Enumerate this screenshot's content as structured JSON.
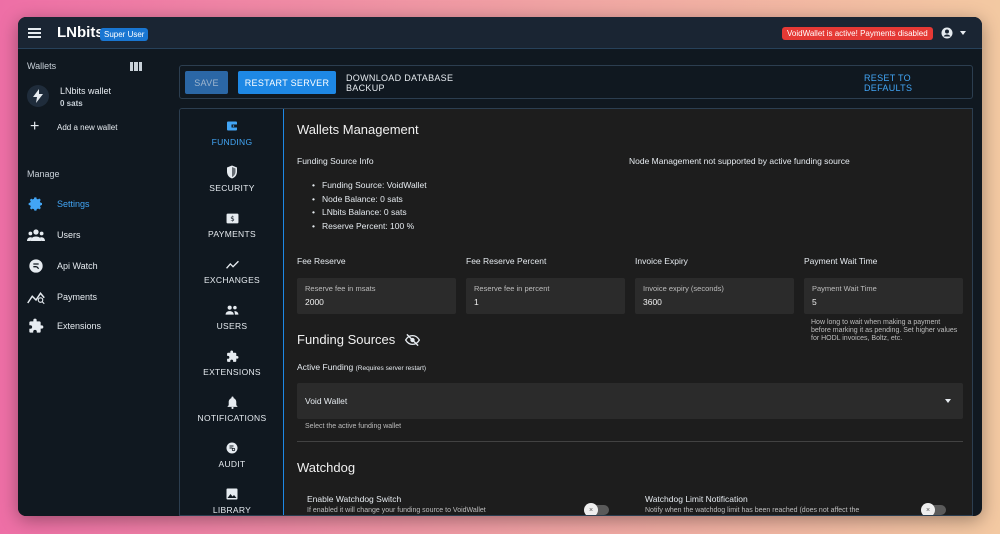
{
  "header": {
    "app_name": "LNbits",
    "role_badge": "Super User",
    "status_badge": "VoidWallet is active! Payments disabled"
  },
  "sidebar": {
    "wallets_title": "Wallets",
    "wallet": {
      "name": "LNbits wallet",
      "balance": "0 sats"
    },
    "add_wallet_label": "Add a new wallet",
    "manage_title": "Manage",
    "items": [
      {
        "label": "Settings",
        "icon": "gear-icon",
        "active": true
      },
      {
        "label": "Users",
        "icon": "users-icon"
      },
      {
        "label": "Api Watch",
        "icon": "api-watch-icon"
      },
      {
        "label": "Payments",
        "icon": "payments-chart-icon"
      },
      {
        "label": "Extensions",
        "icon": "puzzle-icon"
      }
    ]
  },
  "toolbar": {
    "save_label": "SAVE",
    "restart_label": "RESTART SERVER",
    "download_label": "DOWNLOAD DATABASE BACKUP",
    "reset_label": "RESET TO DEFAULTS"
  },
  "tabs": [
    {
      "label": "FUNDING",
      "icon": "wallet-icon",
      "active": true
    },
    {
      "label": "SECURITY",
      "icon": "shield-icon"
    },
    {
      "label": "PAYMENTS",
      "icon": "payments-icon"
    },
    {
      "label": "EXCHANGES",
      "icon": "trend-icon"
    },
    {
      "label": "USERS",
      "icon": "users-icon"
    },
    {
      "label": "EXTENSIONS",
      "icon": "puzzle-icon"
    },
    {
      "label": "NOTIFICATIONS",
      "icon": "bell-icon"
    },
    {
      "label": "AUDIT",
      "icon": "audit-icon"
    },
    {
      "label": "LIBRARY",
      "icon": "image-icon"
    }
  ],
  "main": {
    "title": "Wallets Management",
    "funding_source_info_label": "Funding Source Info",
    "node_management_msg": "Node Management not supported by active funding source",
    "info_items": [
      "Funding Source: VoidWallet",
      "Node Balance: 0 sats",
      "LNbits Balance: 0 sats",
      "Reserve Percent: 100 %"
    ],
    "fields": [
      {
        "title": "Fee Reserve",
        "label": "Reserve fee in msats",
        "value": "2000"
      },
      {
        "title": "Fee Reserve Percent",
        "label": "Reserve fee in percent",
        "value": "1"
      },
      {
        "title": "Invoice Expiry",
        "label": "Invoice expiry (seconds)",
        "value": "3600"
      },
      {
        "title": "Payment Wait Time",
        "label": "Payment Wait Time",
        "value": "5"
      }
    ],
    "payment_wait_hint": "How long to wait when making a payment before marking it as pending. Set higher values for HODL invoices, Boltz, etc.",
    "funding_sources_title": "Funding Sources",
    "active_funding_label": "Active Funding",
    "active_funding_note": "(Requires server restart)",
    "active_funding_value": "Void Wallet",
    "active_funding_hint": "Select the active funding wallet",
    "watchdog_title": "Watchdog",
    "watchdog_switch_title": "Enable Watchdog Switch",
    "watchdog_switch_desc": "If enabled it will change your funding source to VoidWallet",
    "watchdog_limit_title": "Watchdog Limit Notification",
    "watchdog_limit_desc": "Notify when the watchdog limit has been reached (does not affect the"
  },
  "colors": {
    "accent": "#1e88e5",
    "link": "#42a5f5",
    "danger": "#e53935",
    "background": "#101820",
    "panel": "#1d1d1d"
  }
}
